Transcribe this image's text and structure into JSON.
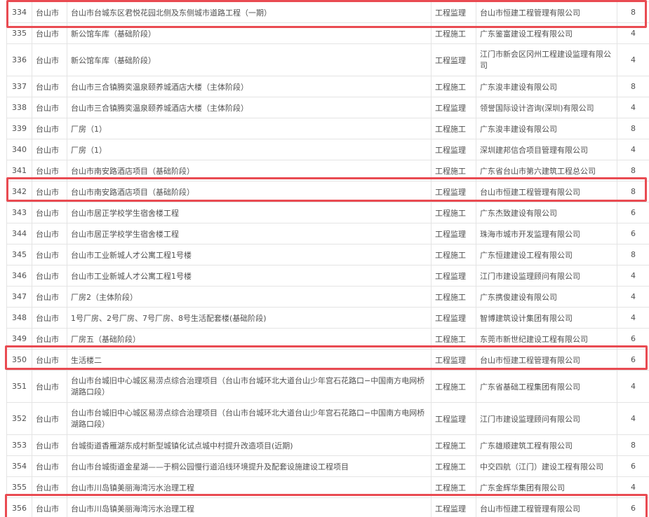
{
  "rows": [
    {
      "no": "334",
      "city": "台山市",
      "name": "台山市台城东区君悦花园北侧及东侧城市道路工程（一期）",
      "type": "工程监理",
      "company": "台山市恒建工程管理有限公司",
      "score": "8"
    },
    {
      "no": "335",
      "city": "台山市",
      "name": "新公馆车库（基础阶段）",
      "type": "工程施工",
      "company": "广东鉴富建设工程有限公司",
      "score": "4"
    },
    {
      "no": "336",
      "city": "台山市",
      "name": "新公馆车库（基础阶段）",
      "type": "工程监理",
      "company": "江门市新会区冈州工程建设监理有限公司",
      "score": "4"
    },
    {
      "no": "337",
      "city": "台山市",
      "name": "台山市三合镇腾奕温泉颐养城酒店大楼（主体阶段）",
      "type": "工程施工",
      "company": "广东浚丰建设有限公司",
      "score": "8"
    },
    {
      "no": "338",
      "city": "台山市",
      "name": "台山市三合镇腾奕温泉颐养城酒店大楼（主体阶段）",
      "type": "工程监理",
      "company": "领誉国际设计咨询(深圳)有限公司",
      "score": "4"
    },
    {
      "no": "339",
      "city": "台山市",
      "name": "厂房（1）",
      "type": "工程施工",
      "company": "广东浚丰建设有限公司",
      "score": "8"
    },
    {
      "no": "340",
      "city": "台山市",
      "name": "厂房（1）",
      "type": "工程监理",
      "company": "深圳建邦信合项目管理有限公司",
      "score": "4"
    },
    {
      "no": "341",
      "city": "台山市",
      "name": "台山市南安路酒店项目（基础阶段）",
      "type": "工程施工",
      "company": "广东省台山市第六建筑工程总公司",
      "score": "8"
    },
    {
      "no": "342",
      "city": "台山市",
      "name": "台山市南安路酒店项目（基础阶段）",
      "type": "工程监理",
      "company": "台山市恒建工程管理有限公司",
      "score": "8"
    },
    {
      "no": "343",
      "city": "台山市",
      "name": "台山市居正学校学生宿舍楼工程",
      "type": "工程施工",
      "company": "广东杰致建设有限公司",
      "score": "6"
    },
    {
      "no": "344",
      "city": "台山市",
      "name": "台山市居正学校学生宿舍楼工程",
      "type": "工程监理",
      "company": "珠海市城市开发监理有限公司",
      "score": "6"
    },
    {
      "no": "345",
      "city": "台山市",
      "name": "台山市工业新城人才公寓工程1号楼",
      "type": "工程施工",
      "company": "广东恒建建设工程有限公司",
      "score": "8"
    },
    {
      "no": "346",
      "city": "台山市",
      "name": "台山市工业新城人才公寓工程1号楼",
      "type": "工程监理",
      "company": "江门市建设监理顾问有限公司",
      "score": "4"
    },
    {
      "no": "347",
      "city": "台山市",
      "name": "厂房2（主体阶段）",
      "type": "工程施工",
      "company": "广东携俊建设有限公司",
      "score": "4"
    },
    {
      "no": "348",
      "city": "台山市",
      "name": "1号厂房、2号厂房、7号厂房、8号生活配套楼(基础阶段)",
      "type": "工程监理",
      "company": "智博建筑设计集团有限公司",
      "score": "4"
    },
    {
      "no": "349",
      "city": "台山市",
      "name": "厂房五（基础阶段）",
      "type": "工程施工",
      "company": "东莞市新世纪建设工程有限公司",
      "score": "6"
    },
    {
      "no": "350",
      "city": "台山市",
      "name": "生活楼二",
      "type": "工程监理",
      "company": "台山市恒建工程管理有限公司",
      "score": "6"
    },
    {
      "no": "351",
      "city": "台山市",
      "name": "台山市台城旧中心城区易涝点综合治理项目（台山市台城环北大道台山少年宫石花路口−中国南方电网桥湖路口段）",
      "type": "工程施工",
      "company": "广东省基础工程集团有限公司",
      "score": "4"
    },
    {
      "no": "352",
      "city": "台山市",
      "name": "台山市台城旧中心城区易涝点综合治理项目（台山市台城环北大道台山少年宫石花路口−中国南方电网桥湖路口段）",
      "type": "工程监理",
      "company": "江门市建设监理顾问有限公司",
      "score": "4"
    },
    {
      "no": "353",
      "city": "台山市",
      "name": "台城街道香雁湖东成村新型城镇化试点城中村提升改造项目(近期)",
      "type": "工程施工",
      "company": "广东雄顺建筑工程有限公司",
      "score": "8"
    },
    {
      "no": "354",
      "city": "台山市",
      "name": "台山市台城街道金星湖——于桐公园慢行道沿线环境提升及配套设施建设工程项目",
      "type": "工程施工",
      "company": "中交四航（江门）建设工程有限公司",
      "score": "6"
    },
    {
      "no": "355",
      "city": "台山市",
      "name": "台山市川岛镇美丽海湾污水治理工程",
      "type": "工程施工",
      "company": "广东金辉华集团有限公司",
      "score": "4"
    },
    {
      "no": "356",
      "city": "台山市",
      "name": "台山市川岛镇美丽海湾污水治理工程",
      "type": "工程监理",
      "company": "台山市恒建工程管理有限公司",
      "score": "6"
    }
  ]
}
